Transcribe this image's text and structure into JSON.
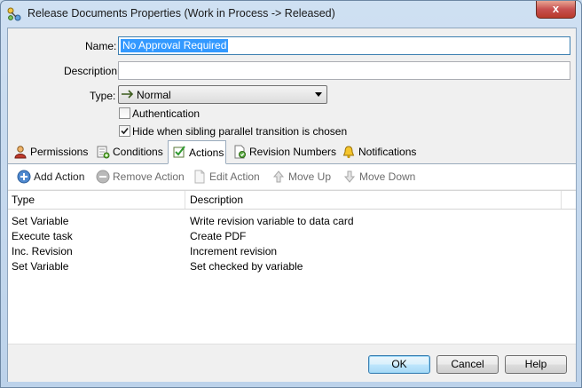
{
  "window": {
    "title": "Release Documents Properties (Work in Process -> Released)",
    "close_label": "x"
  },
  "form": {
    "name_label": "Name:",
    "name_value": "No Approval Required",
    "description_label": "Description:",
    "description_value": "",
    "type_label": "Type:",
    "type_value": "Normal",
    "authentication_label": "Authentication",
    "authentication_checked": false,
    "hide_label": "Hide when sibling parallel transition is chosen",
    "hide_checked": true
  },
  "tabs": [
    {
      "label": "Permissions",
      "icon": "user-icon"
    },
    {
      "label": "Conditions",
      "icon": "conditions-icon"
    },
    {
      "label": "Actions",
      "icon": "check-icon",
      "active": true
    },
    {
      "label": "Revision Numbers",
      "icon": "revision-icon"
    },
    {
      "label": "Notifications",
      "icon": "bell-icon"
    }
  ],
  "toolbar": {
    "add": "Add Action",
    "remove": "Remove Action",
    "edit": "Edit Action",
    "up": "Move Up",
    "down": "Move Down"
  },
  "table": {
    "columns": [
      "Type",
      "Description"
    ],
    "rows": [
      {
        "type": "Set Variable",
        "description": "Write revision variable to data card"
      },
      {
        "type": "Execute task",
        "description": "Create PDF"
      },
      {
        "type": "Inc. Revision",
        "description": "Increment revision"
      },
      {
        "type": "Set Variable",
        "description": "Set checked by variable"
      }
    ]
  },
  "buttons": {
    "ok": "OK",
    "cancel": "Cancel",
    "help": "Help"
  },
  "colors": {
    "selection": "#3399ff",
    "accent": "#3c7fb1",
    "close": "#c75050"
  }
}
